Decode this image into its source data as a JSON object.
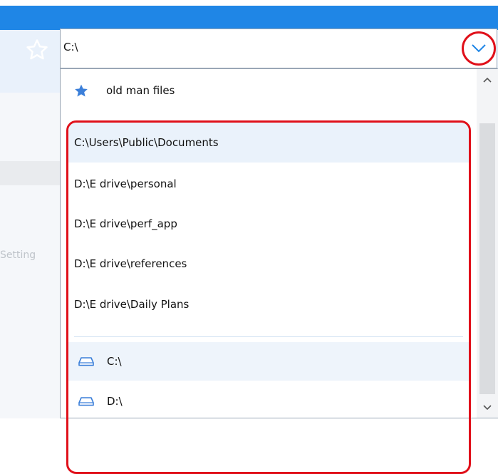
{
  "address_bar": {
    "value": "C:\\"
  },
  "favorites": [
    {
      "label": "old man files",
      "icon": "star-filled-icon"
    }
  ],
  "recent_locations": [
    {
      "path": "C:\\Users\\Public\\Documents"
    },
    {
      "path": "D:\\E drive\\personal"
    },
    {
      "path": "D:\\E drive\\perf_app"
    },
    {
      "path": "D:\\E drive\\references"
    },
    {
      "path": "D:\\E drive\\Daily Plans"
    }
  ],
  "drives": [
    {
      "label": "C:\\",
      "icon": "drive-icon"
    },
    {
      "label": "D:\\",
      "icon": "drive-icon"
    }
  ],
  "background": {
    "partial_text": "Setting"
  },
  "colors": {
    "accent_blue": "#1f86e6",
    "highlight_red": "#e0101a",
    "selection": "#eaf2fb"
  }
}
